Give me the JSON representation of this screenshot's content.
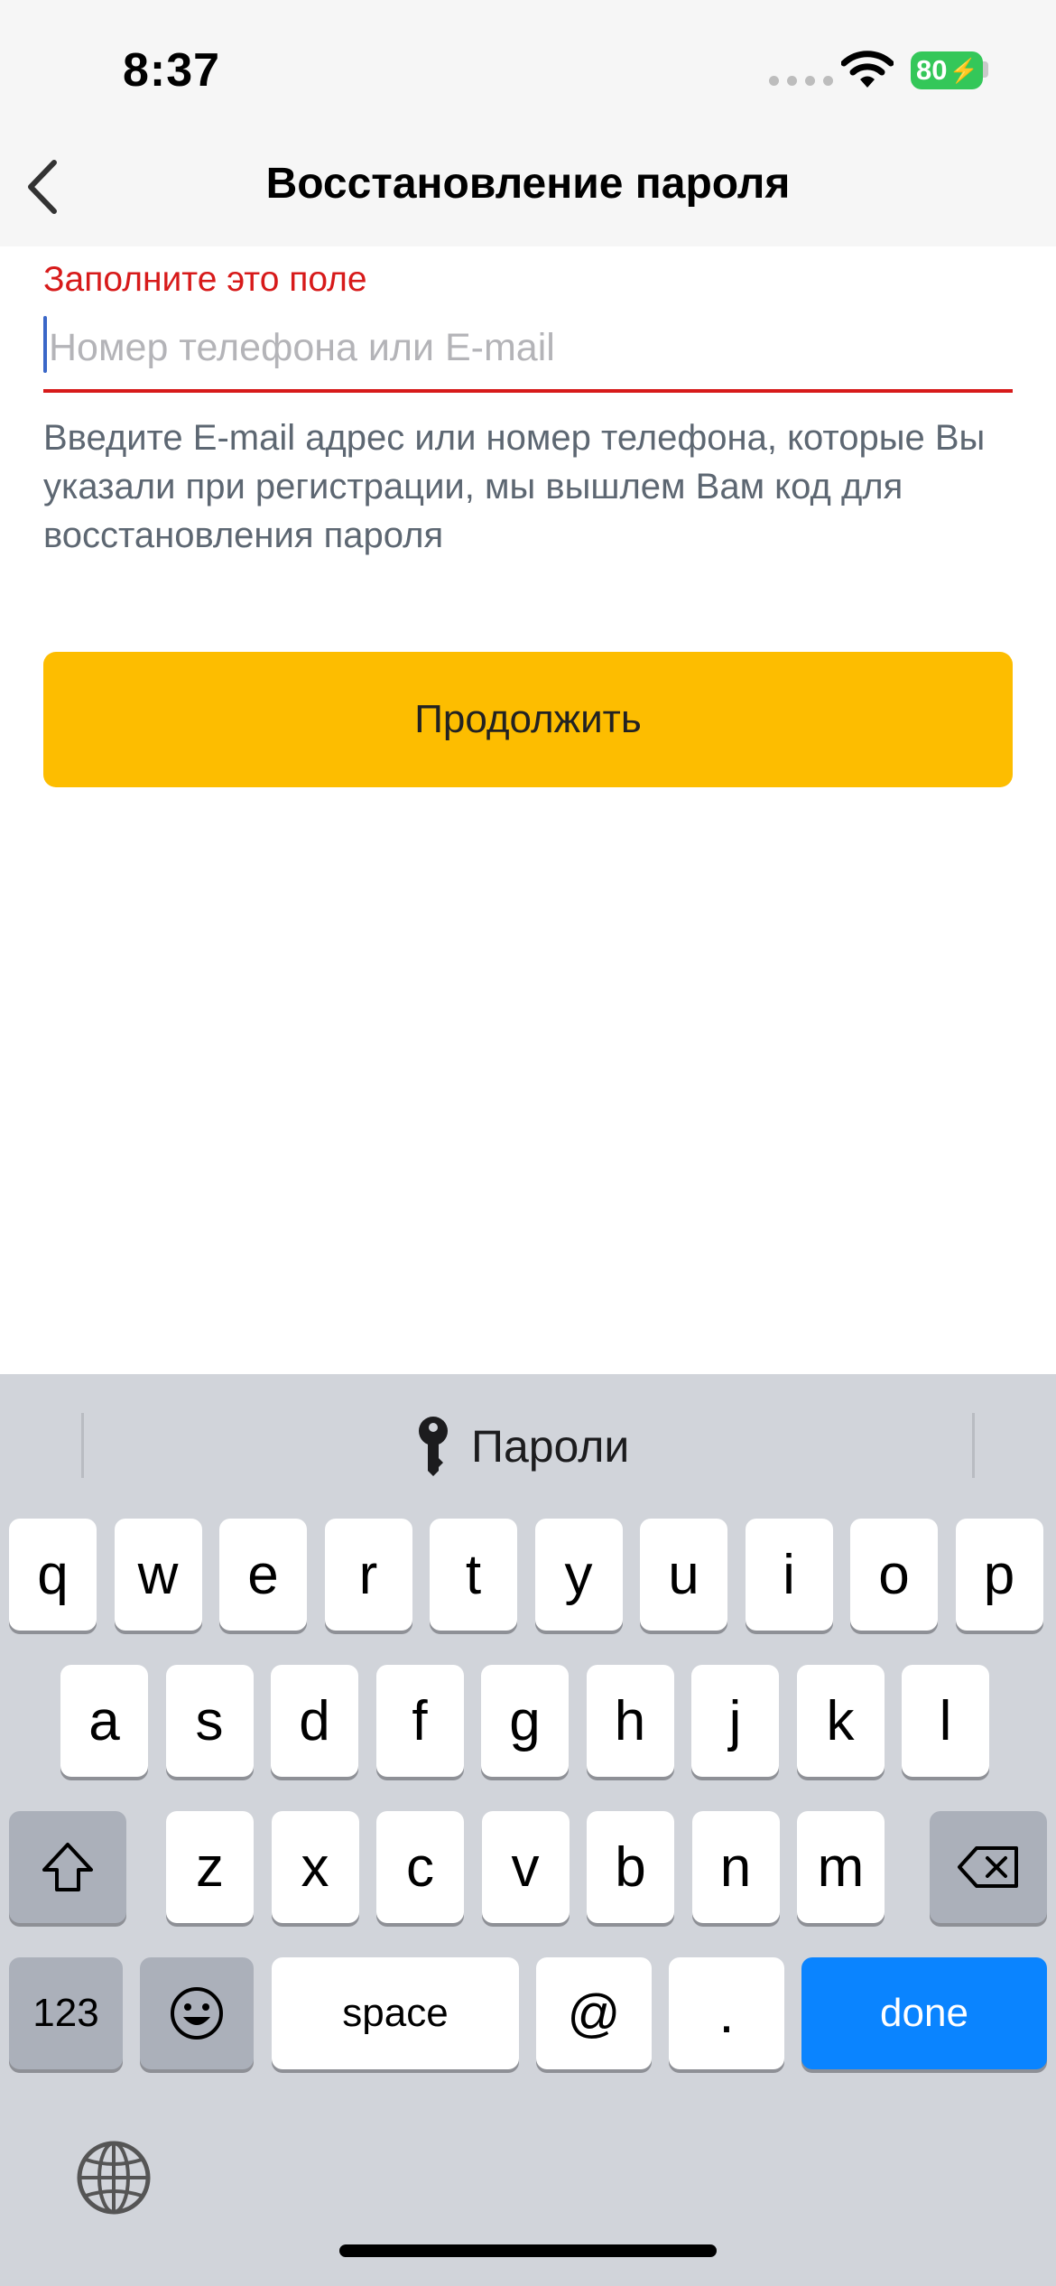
{
  "status_bar": {
    "time": "8:37",
    "battery": "80"
  },
  "nav": {
    "title": "Восстановление пароля"
  },
  "form": {
    "error": "Заполните это поле",
    "placeholder": "Номер телефона или E-mail",
    "value": "",
    "hint": "Введите E-mail адрес или номер телефона, которые Вы указали при регистрации, мы вышлем Вам код для восстановления пароля",
    "continue_label": "Продолжить"
  },
  "keyboard": {
    "suggestion": "Пароли",
    "row1": [
      "q",
      "w",
      "e",
      "r",
      "t",
      "y",
      "u",
      "i",
      "o",
      "p"
    ],
    "row2": [
      "a",
      "s",
      "d",
      "f",
      "g",
      "h",
      "j",
      "k",
      "l"
    ],
    "row3": [
      "z",
      "x",
      "c",
      "v",
      "b",
      "n",
      "m"
    ],
    "numbers_label": "123",
    "space_label": "space",
    "at_label": "@",
    "dot_label": ".",
    "done_label": "done"
  },
  "colors": {
    "accent": "#fdbd00",
    "error": "#d71a1a",
    "done_key": "#0a84ff",
    "battery": "#34c759"
  }
}
